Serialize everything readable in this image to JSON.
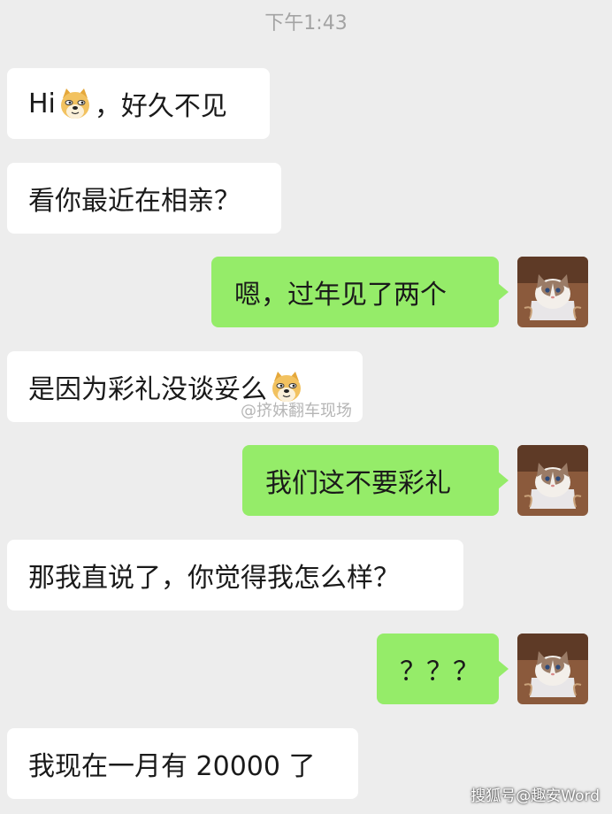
{
  "header": {
    "time": "下午1:43"
  },
  "messages": [
    {
      "side": "left",
      "before": "Hi",
      "emoji": "doge-emoji",
      "after": "，好久不见"
    },
    {
      "side": "left",
      "text": "看你最近在相亲？"
    },
    {
      "side": "right",
      "text": "嗯，过年见了两个"
    },
    {
      "side": "left",
      "text": "是因为彩礼没谈妥么",
      "emoji": "doge-emoji"
    },
    {
      "side": "right",
      "text": "我们这不要彩礼"
    },
    {
      "side": "left",
      "text": "那我直说了，你觉得我怎么样？"
    },
    {
      "side": "right",
      "text": "？？？"
    },
    {
      "side": "left",
      "text": "我现在一月有 20000 了"
    }
  ],
  "watermark": "@挤妹翻车现场",
  "corner_watermark": "搜狐号@趣安Word",
  "colors": {
    "background": "#ededed",
    "left_bubble": "#ffffff",
    "right_bubble": "#95ec69"
  },
  "avatar": "cat-avatar"
}
